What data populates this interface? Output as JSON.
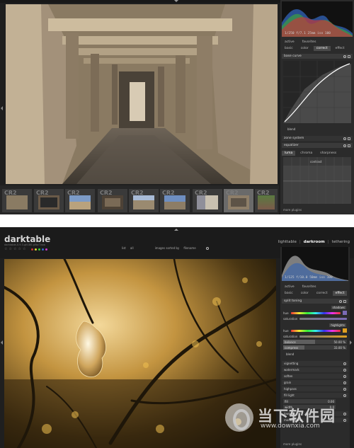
{
  "shot1": {
    "histogram_info": "1/250 f/7.1 25mm iso 100",
    "tabs": [
      "active",
      "favorites",
      "basic",
      "color",
      "correct",
      "effect"
    ],
    "active_tab_index": 4,
    "modules": {
      "base_curve": "base curve",
      "preset_label": "blend",
      "zone_system": "zone system",
      "equalizer": "equalizer",
      "eq_tabs": [
        "luma",
        "chroma",
        "sharpness"
      ],
      "eq_active_tab": "luma",
      "eq_tab_label": "contrast",
      "more_plugins": "more plugins"
    },
    "filmstrip": [
      {
        "label": "CR2",
        "color": "#8a7b63"
      },
      {
        "label": "CR2",
        "color": "#3b3b3b"
      },
      {
        "label": "CR2",
        "color": "#7c9bc7"
      },
      {
        "label": "CR2",
        "color": "#7a6a56"
      },
      {
        "label": "CR2",
        "color": "#9a8a70"
      },
      {
        "label": "CR2",
        "color": "#6e8ec0"
      },
      {
        "label": "CR2",
        "color": "#8f8f9a"
      },
      {
        "label": "CR2",
        "color": "#5d5347"
      },
      {
        "label": "CR2",
        "color": "#7b5a4a"
      }
    ],
    "selected_thumb_index": 7
  },
  "shot2": {
    "app_name": "darktable",
    "version": "darktable-0.9.3-git180-g5bc7aaa",
    "stars": [
      "☆",
      "☆",
      "☆",
      "☆",
      "☆"
    ],
    "color_labels": [
      "#c33",
      "#dd3",
      "#3c3",
      "#36c",
      "#c3c"
    ],
    "filter": {
      "list_label": "list",
      "list_value": "all",
      "sort_label": "images sorted by",
      "sort_value": "filename"
    },
    "views": [
      "lighttable",
      "darkroom",
      "tethering"
    ],
    "active_view": "darkroom",
    "histogram_info": "1/125 f/10.0 50mm iso 100",
    "tabs": [
      "active",
      "favorites",
      "basic",
      "color",
      "correct",
      "effect"
    ],
    "active_tab_index": 5,
    "split_toning": {
      "title": "split toning",
      "shadows_label": "shadows",
      "highlights_label": "highlights",
      "hue": "hue",
      "saturation": "saturation",
      "balance_label": "balance",
      "balance_value": "50.00 %",
      "balance_level": 0.5,
      "compress_label": "compress",
      "compress_value": "33.00 %",
      "compress_level": 0.33,
      "preset": "blend",
      "shadow_color": "#7a6bb4",
      "highlight_color": "#e0a020"
    },
    "modules": [
      "vignetting",
      "watermark",
      "soften",
      "grain",
      "highpass",
      "fill light",
      "lowpass",
      "monochrome"
    ],
    "fill_light": {
      "label_1": "fill",
      "value_1": "0.00",
      "label_2": "width",
      "value_2": "0.0"
    },
    "more_plugins": "more plugins"
  },
  "watermark": {
    "cn": "当下软件园",
    "url": "www.downxia.com"
  }
}
